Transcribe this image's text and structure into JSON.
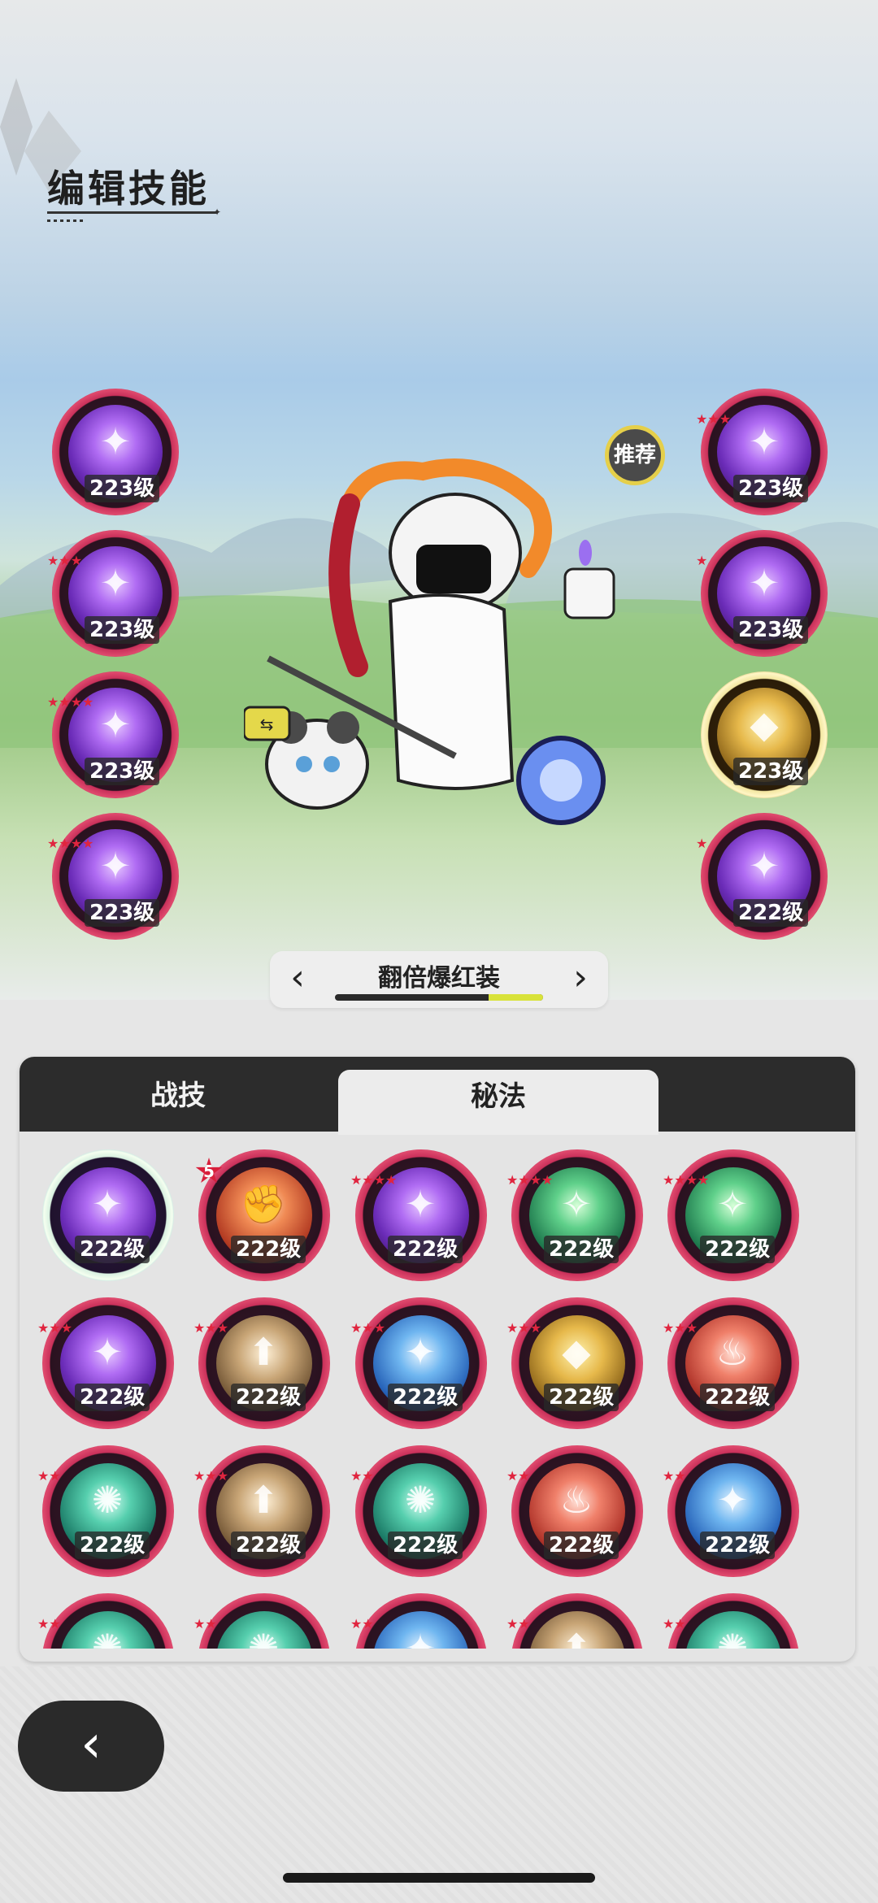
{
  "header": {
    "title": "编辑技能"
  },
  "equipped_left": [
    {
      "level": "223级",
      "stars": 0,
      "theme": "purple",
      "icon": "ultimate-burst-icon"
    },
    {
      "level": "223级",
      "stars": 3,
      "theme": "purple",
      "icon": "crescent-slash-icon"
    },
    {
      "level": "223级",
      "stars": 4,
      "theme": "purple",
      "icon": "raised-hand-icon"
    },
    {
      "level": "223级",
      "stars": 4,
      "theme": "purple",
      "icon": "winged-shield-icon"
    }
  ],
  "equipped_right": [
    {
      "level": "223级",
      "stars": 3,
      "theme": "purple",
      "icon": "crossed-blades-icon"
    },
    {
      "level": "223级",
      "stars": 1,
      "theme": "purple",
      "icon": "eye-vortex-icon"
    },
    {
      "level": "223级",
      "stars": 0,
      "theme": "gold",
      "icon": "golden-figure-icon"
    },
    {
      "level": "222级",
      "stars": 1,
      "theme": "purple",
      "icon": "heart-cloak-icon"
    }
  ],
  "recommend_label": "推荐",
  "swap_icon": "swap-icon",
  "outfit": {
    "name": "翻倍爆红装",
    "prev": "‹",
    "next": "›",
    "progress": 0.26
  },
  "tabs": [
    {
      "label": "战技",
      "active": false
    },
    {
      "label": "秘法",
      "active": true
    }
  ],
  "skill_grid": [
    {
      "level": "222级",
      "stars": 0,
      "badge": "",
      "theme": "purple",
      "icon": "eye-orb-icon"
    },
    {
      "level": "222级",
      "stars": 0,
      "badge": "5",
      "theme": "orange",
      "icon": "fist-impact-icon"
    },
    {
      "level": "222级",
      "stars": 4,
      "badge": "",
      "theme": "purple",
      "icon": "ascend-figure-icon"
    },
    {
      "level": "222级",
      "stars": 4,
      "badge": "",
      "theme": "green",
      "icon": "sparkle-star-icon"
    },
    {
      "level": "222级",
      "stars": 4,
      "badge": "",
      "theme": "green",
      "icon": "potion-bottle-icon"
    },
    {
      "level": "222级",
      "stars": 3,
      "badge": "",
      "theme": "purple",
      "icon": "totem-eye-icon"
    },
    {
      "level": "222级",
      "stars": 3,
      "badge": "",
      "theme": "brown",
      "icon": "arrow-up-ring-icon"
    },
    {
      "level": "222级",
      "stars": 3,
      "badge": "",
      "theme": "blue",
      "icon": "four-point-star-icon"
    },
    {
      "level": "222级",
      "stars": 3,
      "badge": "",
      "theme": "gold",
      "icon": "golden-wind-icon"
    },
    {
      "level": "222级",
      "stars": 3,
      "badge": "",
      "theme": "red",
      "icon": "flame-swirl-icon"
    },
    {
      "level": "222级",
      "stars": 2,
      "badge": "",
      "theme": "teal",
      "icon": "crystal-fist-icon"
    },
    {
      "level": "222级",
      "stars": 3,
      "badge": "",
      "theme": "brown",
      "icon": "power-figure-icon"
    },
    {
      "level": "222级",
      "stars": 2,
      "badge": "",
      "theme": "teal",
      "icon": "green-burst-icon"
    },
    {
      "level": "222级",
      "stars": 2,
      "badge": "",
      "theme": "red",
      "icon": "fire-figure-icon"
    },
    {
      "level": "222级",
      "stars": 2,
      "badge": "",
      "theme": "blue",
      "icon": "water-figure-icon"
    },
    {
      "level": "",
      "stars": 2,
      "badge": "",
      "theme": "teal",
      "icon": "partial-skill-icon"
    },
    {
      "level": "",
      "stars": 2,
      "badge": "",
      "theme": "teal",
      "icon": "partial-skill-icon"
    },
    {
      "level": "",
      "stars": 2,
      "badge": "",
      "theme": "blue",
      "icon": "partial-skill-icon"
    },
    {
      "level": "",
      "stars": 2,
      "badge": "",
      "theme": "brown",
      "icon": "partial-skill-icon"
    },
    {
      "level": "",
      "stars": 2,
      "badge": "",
      "theme": "teal",
      "icon": "partial-skill-icon"
    }
  ],
  "back_button": {
    "label": "‹",
    "icon": "back-arrow-icon"
  }
}
